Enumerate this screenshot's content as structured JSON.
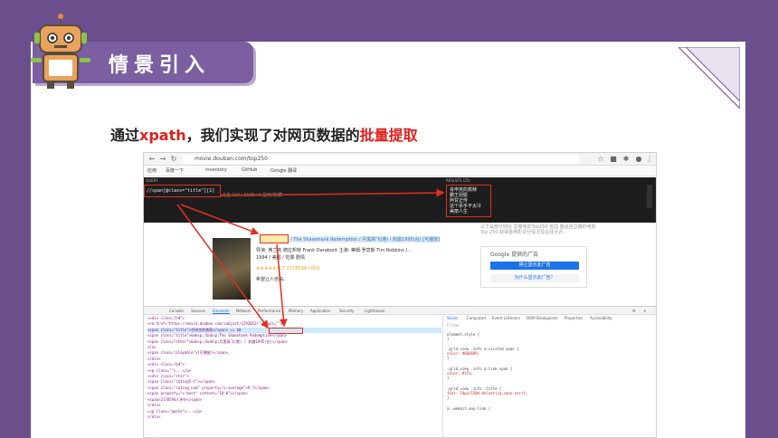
{
  "section_badge": {
    "label": "情景引入"
  },
  "headline": {
    "prefix": "通过",
    "keyword": "xpath",
    "middle": "，我们实现了对网页数据的",
    "emphasis": "批量提取"
  },
  "colors": {
    "frame": "#6b4f8c",
    "badge": "#7b5fa0",
    "accent_red": "#e02020",
    "highlight_box": "#e03020"
  },
  "browser": {
    "url": "movie.douban.com/top250",
    "bookmarks": [
      "应用",
      "百度一下",
      "inventory",
      "GitHub",
      "Google 翻译"
    ],
    "xpath_panel": {
      "query_label": "QUERY",
      "query": "//span[@class=\"title\"][1]",
      "query_hint": "点击 Ctrl+Shift+X 显示/隐藏",
      "results_label": "RESULTS (25)",
      "results": [
        "肖申克的救赎",
        "霸王别姬",
        "阿甘正传",
        "这个杀手不太冷",
        "美丽人生"
      ]
    },
    "page": {
      "film_title": "/ The Shawshank Redemption / 月黑高飞(港) / 刺激1995(台) [可播放]",
      "meta_1": "导演: 弗兰克·德拉邦特 Frank Darabont 主演: 蒂姆·罗宾斯 Tim Robbins /...",
      "meta_2": "1994 / 美国 / 犯罪 剧情",
      "rating": "★★★★★ 9.7 2178594人评价",
      "quote": "希望让人自由。",
      "side_text": "以下是部分网址 豆瓣电影Top250 各国 搬运自豆瓣的电影Top 250 获得各电影评分情况及在线点评...",
      "google_ad": "Google 提供的广告",
      "ad_button_1": "停止显示此广告",
      "ad_button_2": "为什么显示此广告？"
    },
    "devtools": {
      "tabs": [
        "Console",
        "Sources",
        "Elements",
        "Network",
        "Performance",
        "Memory",
        "Application",
        "Security",
        "Lighthouse"
      ],
      "active_tab": "Elements",
      "code_lines": [
        "▾<div class=\"hd\">",
        "  ▾<a href=\"https://movie.douban.com/subject/1292052/\" class=\"\">",
        "    <span class=\"title\">肖申克的救赎</span> == $0",
        "    <span class=\"title\">&nbsp;/&nbsp;The Shawshank Redemption</span>",
        "    <span class=\"other\">&nbsp;/&nbsp;月黑高飞(港) / 刺激1995(台)</span>",
        "  </a>",
        "  <span class=\"playable\">[可播放]</span>",
        "</div>",
        "▾<div class=\"bd\">",
        "  ▸<p class=\"\">...</p>",
        "  ▾<div class=\"star\">",
        "    <span class=\"rating5-t\"></span>",
        "    <span class=\"rating_num\" property=\"v:average\">9.7</span>",
        "    <span property=\"v:best\" content=\"10.0\"></span>",
        "    <span>2178594人评价</span>",
        "  </div>",
        "  ▸<p class=\"quote\">...</p>",
        "</div>"
      ],
      "style_tabs": [
        "Styles",
        "Computed",
        "Event Listeners",
        "DOM Breakpoints",
        "Properties",
        "Accessibility"
      ],
      "filter_placeholder": "Filter",
      "style_rules": [
        "element.style {",
        "}",
        ".grid_view .info a:visited span {",
        "  color: #666699;",
        "}",
        ".grid_view .info a:link span {",
        "  color: #37a;",
        "}",
        ".grid_view .info .title {",
        "  font: 14px/150% Helvetica,sans-serif;",
        "}",
        "a:-webkit-any-link {"
      ]
    }
  }
}
